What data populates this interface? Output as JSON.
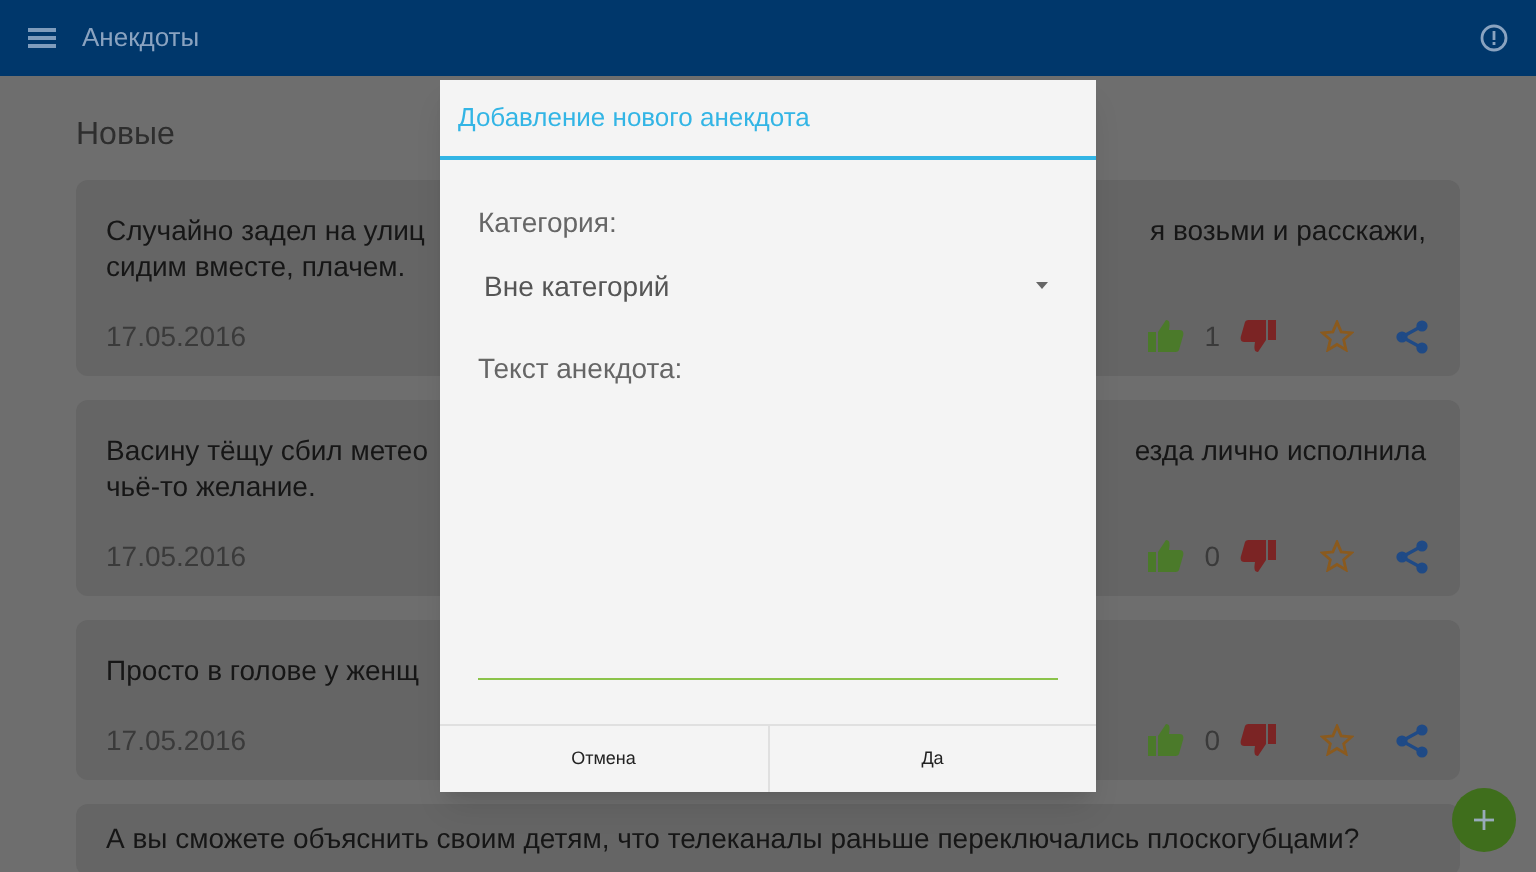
{
  "app_bar": {
    "title": "Анекдоты"
  },
  "section_title": "Новые",
  "cards": [
    {
      "line_1_start": "Случайно задел на улиц",
      "line_1_end": "я возьми и расскажи,",
      "line_2": "сидим вместе, плачем.",
      "date": "17.05.2016",
      "likes": "1"
    },
    {
      "line_1_start": "Васину тёщу сбил метео",
      "line_1_end": "езда лично исполнила",
      "line_2": "чьё-то желание.",
      "date": "17.05.2016",
      "likes": "0"
    },
    {
      "line_1_start": "Просто в голове у женщ",
      "date": "17.05.2016",
      "likes": "0"
    },
    {
      "line_1_start": "А вы сможете объяснить своим детям, что телеканалы раньше переключались плоскогубцами?"
    }
  ],
  "dialog": {
    "title": "Добавление нового анекдота",
    "category_label": "Категория:",
    "category_value": "Вне категорий",
    "text_label": "Текст анекдота:",
    "buttons": [
      "Отмена",
      "Да"
    ]
  }
}
